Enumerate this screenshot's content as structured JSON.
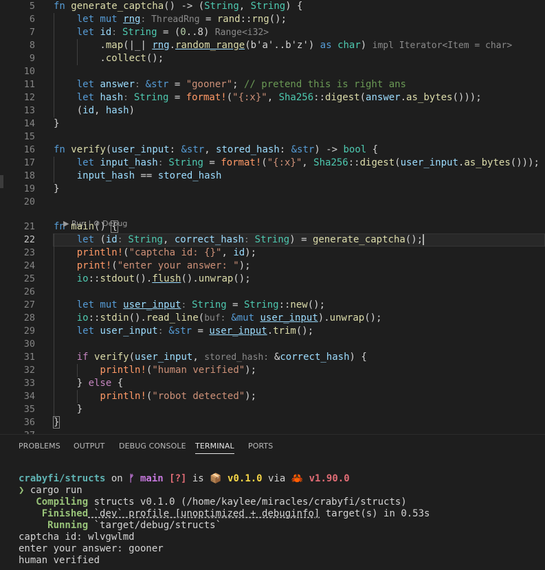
{
  "editor": {
    "active_line": "22",
    "codelens": {
      "run": "▶ Run",
      "sep": " | ",
      "debug": "⚙ Debug"
    },
    "lines": [
      {
        "n": "5",
        "tokens": [
          [
            "kw",
            "fn "
          ],
          [
            "fn",
            "generate_captcha"
          ],
          [
            "plain",
            "() -> ("
          ],
          [
            "ty",
            "String"
          ],
          [
            "plain",
            ", "
          ],
          [
            "ty",
            "String"
          ],
          [
            "plain",
            ") {"
          ]
        ]
      },
      {
        "n": "6",
        "tokens": [
          [
            "plain",
            "    "
          ],
          [
            "kw",
            "let mut "
          ],
          [
            "var ul",
            "rng"
          ],
          [
            "hint",
            ": ThreadRng"
          ],
          [
            "plain",
            " = "
          ],
          [
            "fn",
            "rand"
          ],
          [
            "plain",
            "::"
          ],
          [
            "fn",
            "rng"
          ],
          [
            "plain",
            "();"
          ]
        ]
      },
      {
        "n": "7",
        "tokens": [
          [
            "plain",
            "    "
          ],
          [
            "kw",
            "let "
          ],
          [
            "var",
            "id"
          ],
          [
            "hint",
            ": "
          ],
          [
            "ty",
            "String"
          ],
          [
            "plain",
            " = ("
          ],
          [
            "num",
            "0"
          ],
          [
            "plain",
            "..8) "
          ],
          [
            "hint",
            "Range<i32>"
          ]
        ]
      },
      {
        "n": "8",
        "tokens": [
          [
            "plain",
            "        ."
          ],
          [
            "fn",
            "map"
          ],
          [
            "plain",
            "(|_| "
          ],
          [
            "var ul",
            "rng"
          ],
          [
            "plain",
            "."
          ],
          [
            "fn ul",
            "random_range"
          ],
          [
            "plain",
            "(b'a'..b'z') "
          ],
          [
            "kw",
            "as "
          ],
          [
            "ty",
            "char"
          ],
          [
            "plain",
            ") "
          ],
          [
            "hint",
            "impl Iterator<Item = char>"
          ]
        ]
      },
      {
        "n": "9",
        "tokens": [
          [
            "plain",
            "        ."
          ],
          [
            "fn",
            "collect"
          ],
          [
            "plain",
            "();"
          ]
        ]
      },
      {
        "n": "10",
        "tokens": []
      },
      {
        "n": "11",
        "tokens": [
          [
            "plain",
            "    "
          ],
          [
            "kw",
            "let "
          ],
          [
            "var",
            "answer"
          ],
          [
            "hint",
            ": "
          ],
          [
            "kw",
            "&str"
          ],
          [
            "plain",
            " = "
          ],
          [
            "str",
            "\"gooner\""
          ],
          [
            "plain",
            "; "
          ],
          [
            "cm",
            "// pretend this is right ans"
          ]
        ]
      },
      {
        "n": "12",
        "tokens": [
          [
            "plain",
            "    "
          ],
          [
            "kw",
            "let "
          ],
          [
            "var",
            "hash"
          ],
          [
            "hint",
            ": "
          ],
          [
            "ty",
            "String"
          ],
          [
            "plain",
            " = "
          ],
          [
            "mac2",
            "format!"
          ],
          [
            "plain",
            "("
          ],
          [
            "str",
            "\"{:x}\""
          ],
          [
            "plain",
            ", "
          ],
          [
            "ty",
            "Sha256"
          ],
          [
            "plain",
            "::"
          ],
          [
            "fn",
            "digest"
          ],
          [
            "plain",
            "("
          ],
          [
            "var",
            "answer"
          ],
          [
            "plain",
            "."
          ],
          [
            "fn",
            "as_bytes"
          ],
          [
            "plain",
            "()));"
          ]
        ]
      },
      {
        "n": "13",
        "tokens": [
          [
            "plain",
            "    ("
          ],
          [
            "var",
            "id"
          ],
          [
            "plain",
            ", "
          ],
          [
            "var",
            "hash"
          ],
          [
            "plain",
            ")"
          ]
        ]
      },
      {
        "n": "14",
        "tokens": [
          [
            "plain",
            "}"
          ]
        ]
      },
      {
        "n": "15",
        "tokens": []
      },
      {
        "n": "16",
        "tokens": [
          [
            "kw",
            "fn "
          ],
          [
            "fn",
            "verify"
          ],
          [
            "plain",
            "("
          ],
          [
            "var",
            "user_input"
          ],
          [
            "plain",
            ": "
          ],
          [
            "kw",
            "&str"
          ],
          [
            "plain",
            ", "
          ],
          [
            "var",
            "stored_hash"
          ],
          [
            "plain",
            ": "
          ],
          [
            "kw",
            "&str"
          ],
          [
            "plain",
            ") -> "
          ],
          [
            "ty",
            "bool"
          ],
          [
            "plain",
            " {"
          ]
        ]
      },
      {
        "n": "17",
        "tokens": [
          [
            "plain",
            "    "
          ],
          [
            "kw",
            "let "
          ],
          [
            "var",
            "input_hash"
          ],
          [
            "hint",
            ": "
          ],
          [
            "ty",
            "String"
          ],
          [
            "plain",
            " = "
          ],
          [
            "mac2",
            "format!"
          ],
          [
            "plain",
            "("
          ],
          [
            "str",
            "\"{:x}\""
          ],
          [
            "plain",
            ", "
          ],
          [
            "ty",
            "Sha256"
          ],
          [
            "plain",
            "::"
          ],
          [
            "fn",
            "digest"
          ],
          [
            "plain",
            "("
          ],
          [
            "var",
            "user_input"
          ],
          [
            "plain",
            "."
          ],
          [
            "fn",
            "as_bytes"
          ],
          [
            "plain",
            "()));"
          ]
        ]
      },
      {
        "n": "18",
        "tokens": [
          [
            "plain",
            "    "
          ],
          [
            "var",
            "input_hash"
          ],
          [
            "plain",
            " == "
          ],
          [
            "var",
            "stored_hash"
          ]
        ]
      },
      {
        "n": "19",
        "tokens": [
          [
            "plain",
            "}"
          ]
        ]
      },
      {
        "n": "20",
        "tokens": []
      },
      {
        "n": "21",
        "tokens": [
          [
            "kw",
            "fn "
          ],
          [
            "fn",
            "main"
          ],
          [
            "plain",
            "() "
          ],
          [
            "plain brace-hl",
            "{"
          ]
        ]
      },
      {
        "n": "22",
        "tokens": [
          [
            "plain",
            "    "
          ],
          [
            "kw",
            "let "
          ],
          [
            "plain",
            "("
          ],
          [
            "var",
            "id"
          ],
          [
            "hint",
            ": "
          ],
          [
            "ty",
            "String"
          ],
          [
            "plain",
            ", "
          ],
          [
            "var",
            "correct_hash"
          ],
          [
            "hint",
            ": "
          ],
          [
            "ty",
            "String"
          ],
          [
            "plain",
            ") = "
          ],
          [
            "fn",
            "generate_captcha"
          ],
          [
            "plain cursor",
            "();"
          ]
        ]
      },
      {
        "n": "23",
        "tokens": [
          [
            "plain",
            "    "
          ],
          [
            "mac2",
            "println!"
          ],
          [
            "plain",
            "("
          ],
          [
            "str",
            "\"captcha id: {}\""
          ],
          [
            "plain",
            ", "
          ],
          [
            "var",
            "id"
          ],
          [
            "plain",
            ");"
          ]
        ]
      },
      {
        "n": "24",
        "tokens": [
          [
            "plain",
            "    "
          ],
          [
            "mac2",
            "print!"
          ],
          [
            "plain",
            "("
          ],
          [
            "str",
            "\"enter your answer: \""
          ],
          [
            "plain",
            ");"
          ]
        ]
      },
      {
        "n": "25",
        "tokens": [
          [
            "plain",
            "    "
          ],
          [
            "ty",
            "io"
          ],
          [
            "plain",
            "::"
          ],
          [
            "fn",
            "stdout"
          ],
          [
            "plain",
            "()."
          ],
          [
            "fn ul",
            "flush"
          ],
          [
            "plain",
            "()."
          ],
          [
            "fn",
            "unwrap"
          ],
          [
            "plain",
            "();"
          ]
        ]
      },
      {
        "n": "26",
        "tokens": []
      },
      {
        "n": "27",
        "tokens": [
          [
            "plain",
            "    "
          ],
          [
            "kw",
            "let mut "
          ],
          [
            "var ul",
            "user_input"
          ],
          [
            "hint",
            ": "
          ],
          [
            "ty",
            "String"
          ],
          [
            "plain",
            " = "
          ],
          [
            "ty",
            "String"
          ],
          [
            "plain",
            "::"
          ],
          [
            "fn",
            "new"
          ],
          [
            "plain",
            "();"
          ]
        ]
      },
      {
        "n": "28",
        "tokens": [
          [
            "plain",
            "    "
          ],
          [
            "ty",
            "io"
          ],
          [
            "plain",
            "::"
          ],
          [
            "fn",
            "stdin"
          ],
          [
            "plain",
            "()."
          ],
          [
            "fn",
            "read_line"
          ],
          [
            "plain",
            "("
          ],
          [
            "hint",
            "buf: "
          ],
          [
            "kw",
            "&mut "
          ],
          [
            "var ul",
            "user_input"
          ],
          [
            "plain",
            ")."
          ],
          [
            "fn",
            "unwrap"
          ],
          [
            "plain",
            "();"
          ]
        ]
      },
      {
        "n": "29",
        "tokens": [
          [
            "plain",
            "    "
          ],
          [
            "kw",
            "let "
          ],
          [
            "var",
            "user_input"
          ],
          [
            "hint",
            ": "
          ],
          [
            "kw",
            "&str"
          ],
          [
            "plain",
            " = "
          ],
          [
            "var ul",
            "user_input"
          ],
          [
            "plain",
            "."
          ],
          [
            "fn",
            "trim"
          ],
          [
            "plain",
            "();"
          ]
        ]
      },
      {
        "n": "30",
        "tokens": []
      },
      {
        "n": "31",
        "tokens": [
          [
            "plain",
            "    "
          ],
          [
            "ctl",
            "if "
          ],
          [
            "fn",
            "verify"
          ],
          [
            "plain",
            "("
          ],
          [
            "var",
            "user_input"
          ],
          [
            "plain",
            ", "
          ],
          [
            "hint",
            "stored_hash: "
          ],
          [
            "plain",
            "&"
          ],
          [
            "var",
            "correct_hash"
          ],
          [
            "plain",
            ") {"
          ]
        ]
      },
      {
        "n": "32",
        "tokens": [
          [
            "plain",
            "        "
          ],
          [
            "mac2",
            "println!"
          ],
          [
            "plain",
            "("
          ],
          [
            "str",
            "\"human verified\""
          ],
          [
            "plain",
            ");"
          ]
        ]
      },
      {
        "n": "33",
        "tokens": [
          [
            "plain",
            "    } "
          ],
          [
            "ctl",
            "else"
          ],
          [
            "plain",
            " {"
          ]
        ]
      },
      {
        "n": "34",
        "tokens": [
          [
            "plain",
            "        "
          ],
          [
            "mac2",
            "println!"
          ],
          [
            "plain",
            "("
          ],
          [
            "str",
            "\"robot detected\""
          ],
          [
            "plain",
            ");"
          ]
        ]
      },
      {
        "n": "35",
        "tokens": [
          [
            "plain",
            "    }"
          ]
        ]
      },
      {
        "n": "36",
        "tokens": [
          [
            "plain brace-hl",
            "}"
          ]
        ]
      },
      {
        "n": "37",
        "tokens": []
      }
    ]
  },
  "panel": {
    "tabs": [
      "PROBLEMS",
      "OUTPUT",
      "DEBUG CONSOLE",
      "TERMINAL",
      "PORTS"
    ],
    "active_tab": "TERMINAL"
  },
  "terminal": {
    "lines": [
      [
        [
          "t-path",
          "crabyfi/structs"
        ],
        [
          "t-dim",
          " on "
        ],
        [
          "t-branch",
          "ᚠ main"
        ],
        [
          "t-dim",
          " "
        ],
        [
          "t-red",
          "[?]"
        ],
        [
          "t-dim",
          " is "
        ],
        [
          "t-dim",
          "📦 "
        ],
        [
          "t-yellow",
          "v0.1.0"
        ],
        [
          "t-dim",
          " via "
        ],
        [
          "t-rust",
          "🦀 v1.90.0"
        ]
      ],
      [
        [
          "t-prompt",
          "❯ "
        ],
        [
          "t-dim",
          "cargo run"
        ]
      ],
      [
        [
          "t-green",
          "   Compiling"
        ],
        [
          "t-dim",
          " structs v0.1.0 (/home/kaylee/miracles/crabyfi/structs)"
        ]
      ],
      [
        [
          "t-green",
          "    Finished"
        ],
        [
          "t-dim t-dul",
          " `dev` profile [unoptimized + debuginfo]"
        ],
        [
          "t-dim",
          " target(s) in 0.53s"
        ]
      ],
      [
        [
          "t-green",
          "     Running"
        ],
        [
          "t-dim",
          " `target/debug/structs`"
        ]
      ],
      [
        [
          "t-dim",
          "captcha id: wlvgwlmd"
        ]
      ],
      [
        [
          "t-dim",
          "enter your answer: gooner"
        ]
      ],
      [
        [
          "t-dim",
          "human verified"
        ]
      ]
    ]
  }
}
